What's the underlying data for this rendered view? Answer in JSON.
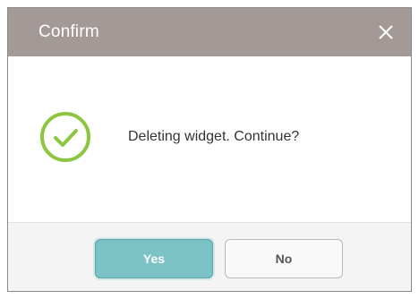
{
  "dialog": {
    "title": "Confirm",
    "close_icon": "close-icon",
    "status_icon": "check-circle-icon",
    "message": "Deleting widget. Continue?",
    "buttons": {
      "yes_label": "Yes",
      "no_label": "No"
    }
  },
  "colors": {
    "titlebar": "#a39997",
    "check": "#8cc63f",
    "yes_button": "#7cc1c6"
  }
}
